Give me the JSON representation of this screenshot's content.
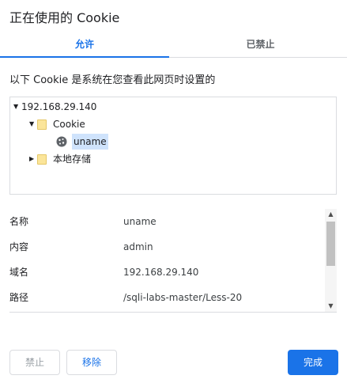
{
  "dialog": {
    "title": "正在使用的 Cookie"
  },
  "tabs": [
    {
      "label": "允许",
      "active": true
    },
    {
      "label": "已禁止",
      "active": false
    }
  ],
  "description": "以下 Cookie 是系统在您查看此网页时设置的",
  "tree": {
    "host": "192.168.29.140",
    "cookie_folder": "Cookie",
    "cookie_item": "uname",
    "local_storage": "本地存储"
  },
  "details": [
    {
      "label": "名称",
      "value": "uname"
    },
    {
      "label": "内容",
      "value": "admin"
    },
    {
      "label": "域名",
      "value": "192.168.29.140"
    },
    {
      "label": "路径",
      "value": "/sqli-labs-master/Less-20"
    }
  ],
  "buttons": {
    "block": "禁止",
    "remove": "移除",
    "done": "完成"
  },
  "colors": {
    "accent": "#1a73e8",
    "selection": "#cfe3fc",
    "folder": "#fbe59a"
  }
}
